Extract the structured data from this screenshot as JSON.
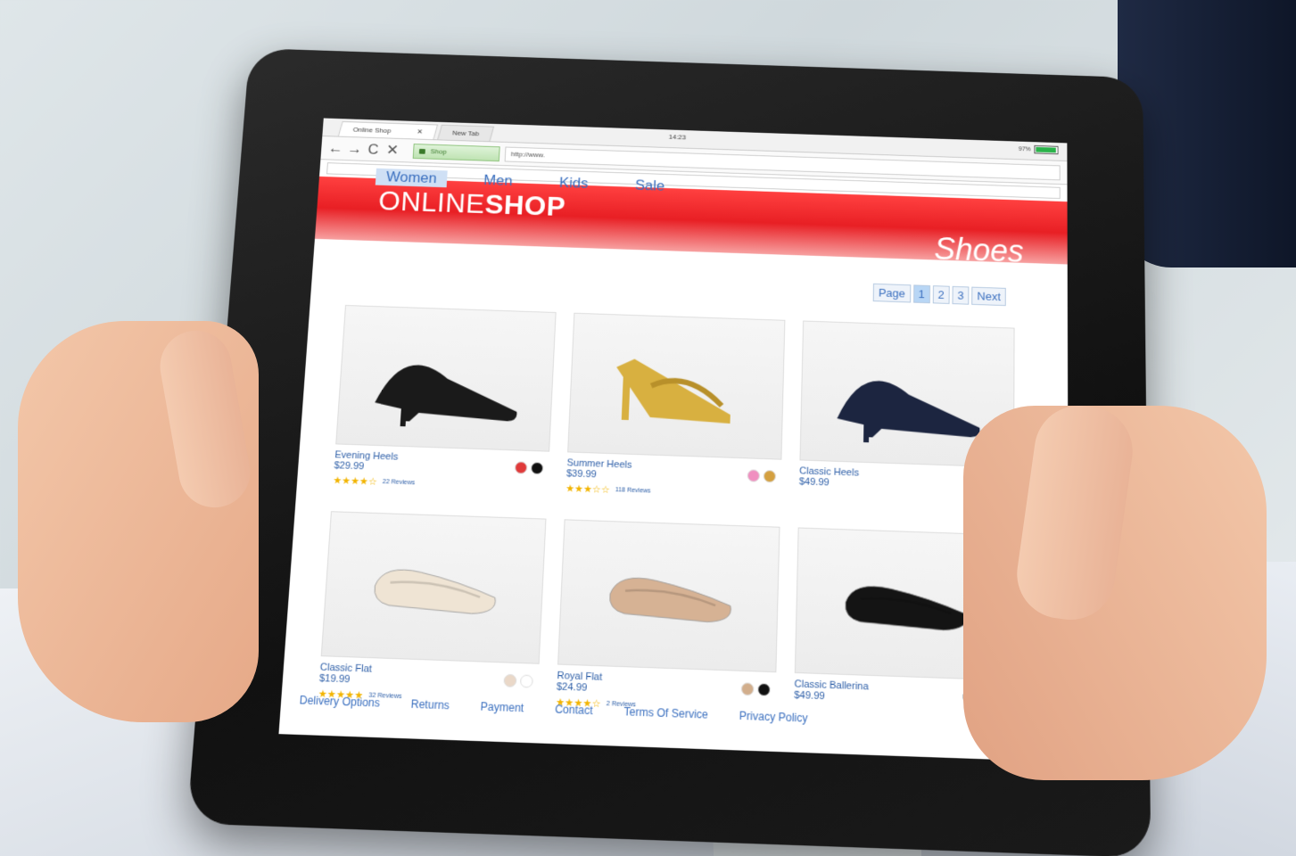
{
  "browser": {
    "tabs": [
      {
        "label": "Online Shop",
        "close": "✕"
      },
      {
        "label": "New Tab",
        "close": ""
      }
    ],
    "time": "14:23",
    "battery": {
      "label": "97%",
      "level": 0.97,
      "color": "#2ab34a"
    },
    "nav": {
      "back": "←",
      "forward": "→",
      "reload": "C",
      "stop": "✕"
    },
    "shop_pill": "Shop",
    "url": "http://www."
  },
  "header": {
    "logo_light": "ONLINE",
    "logo_bold": "SHOP",
    "section": "Shoes",
    "accent_color": "#e81f24"
  },
  "categories": [
    {
      "label": "Women",
      "active": true
    },
    {
      "label": "Men",
      "active": false
    },
    {
      "label": "Kids",
      "active": false
    },
    {
      "label": "Sale",
      "active": false
    }
  ],
  "pagination": {
    "label": "Page",
    "pages": [
      "1",
      "2",
      "3"
    ],
    "current": "1",
    "next": "Next"
  },
  "products": [
    {
      "name": "Evening Heels",
      "price": "$29.99",
      "rating": 4,
      "reviews": "22 Reviews",
      "colors": [
        "#e03a3a",
        "#111111"
      ],
      "shoe_color": "#1a1a1a",
      "shoe_type": "heel"
    },
    {
      "name": "Summer Heels",
      "price": "$39.99",
      "rating": 3,
      "reviews": "118 Reviews",
      "colors": [
        "#f08fc0",
        "#d4a040"
      ],
      "shoe_color": "#d8b040",
      "shoe_type": "sandal"
    },
    {
      "name": "Classic Heels",
      "price": "$49.99",
      "rating": 0,
      "reviews": "",
      "colors": [
        "#111111",
        "#2a2a8a"
      ],
      "shoe_color": "#1c2540",
      "shoe_type": "heel"
    },
    {
      "name": "Classic Flat",
      "price": "$19.99",
      "rating": 5,
      "reviews": "32 Reviews",
      "colors": [
        "#ead8c8",
        "#ffffff"
      ],
      "shoe_color": "#efe4d4",
      "shoe_type": "flat"
    },
    {
      "name": "Royal Flat",
      "price": "$24.99",
      "rating": 4,
      "reviews": "2 Reviews",
      "colors": [
        "#d2ae8c",
        "#111111"
      ],
      "shoe_color": "#d6b294",
      "shoe_type": "flat"
    },
    {
      "name": "Classic Ballerina",
      "price": "$49.99",
      "rating": 0,
      "reviews": "",
      "colors": [
        "#111111",
        "#e02a3a",
        "#19b4e6"
      ],
      "shoe_color": "#141414",
      "shoe_type": "flat"
    }
  ],
  "footer": [
    "Delivery Options",
    "Returns",
    "Payment",
    "Contact",
    "Terms Of Service",
    "Privacy Policy"
  ]
}
